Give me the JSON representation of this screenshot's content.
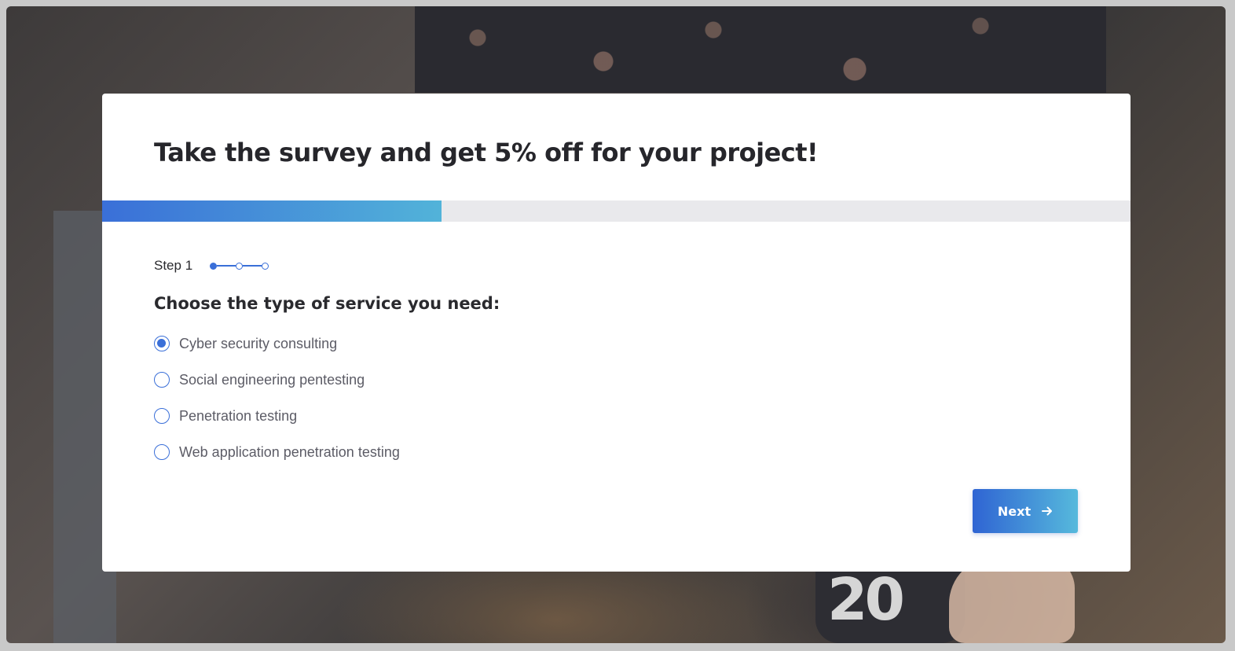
{
  "survey": {
    "title": "Take the survey and get 5% off for your project!",
    "progress": 0.33,
    "step_label": "Step 1",
    "steps_total": 3,
    "current_step": 1,
    "question": "Choose the type of service you need:",
    "options": [
      {
        "label": "Cyber security consulting",
        "selected": true
      },
      {
        "label": "Social engineering pentesting",
        "selected": false
      },
      {
        "label": "Penetration testing",
        "selected": false
      },
      {
        "label": "Web application penetration testing",
        "selected": false
      }
    ],
    "next_label": "Next"
  },
  "background": {
    "mug_text": "20"
  },
  "colors": {
    "accent": "#3a6fd8",
    "accent_light": "#52b3d9",
    "title": "#26262b"
  },
  "icons": {
    "next": "arrow-right-icon"
  }
}
